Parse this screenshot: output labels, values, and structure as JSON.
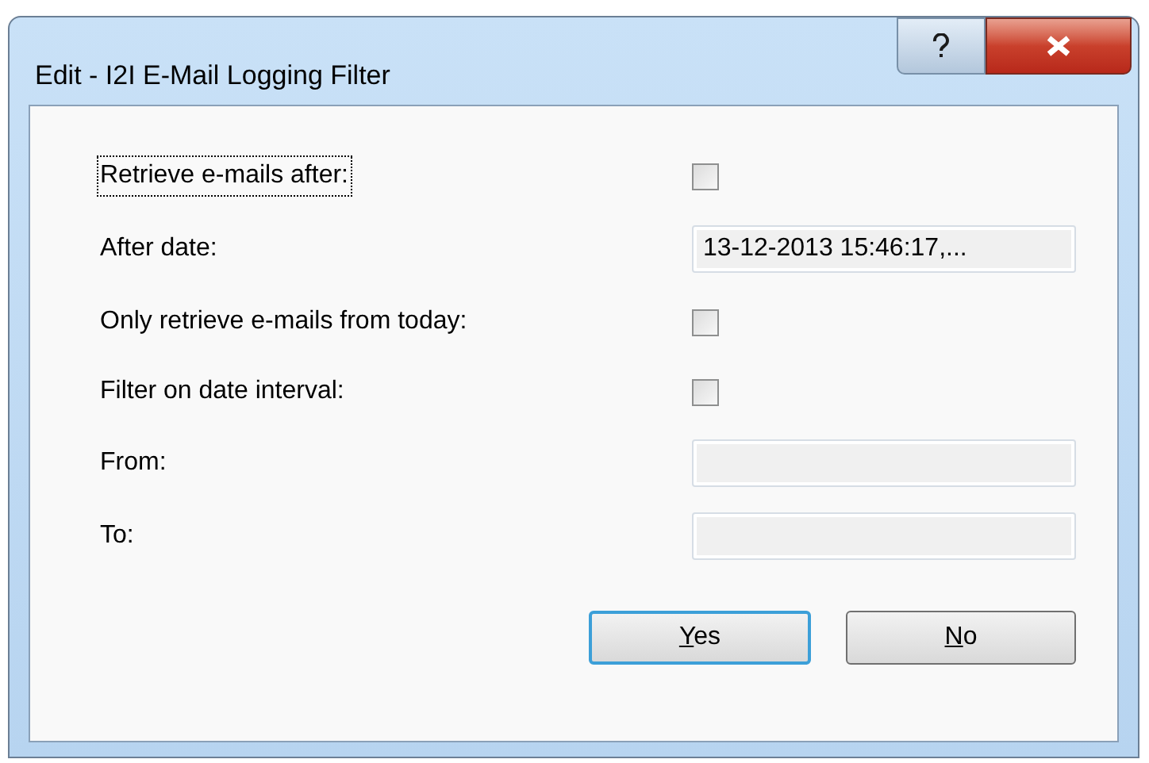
{
  "window": {
    "title": "Edit - I2I E-Mail Logging Filter"
  },
  "rows": [
    {
      "kind": "checkbox",
      "label": "Retrieve e-mails after:",
      "focused": true,
      "checked": false
    },
    {
      "kind": "field",
      "label": "After date:",
      "focused": false,
      "value": "13-12-2013 15:46:17,...",
      "disabled": true
    },
    {
      "kind": "checkbox",
      "label": "Only retrieve e-mails from today:",
      "focused": false,
      "checked": false
    },
    {
      "kind": "checkbox",
      "label": "Filter on date interval:",
      "focused": false,
      "checked": false
    },
    {
      "kind": "field",
      "label": "From:",
      "focused": false,
      "disabled": true
    },
    {
      "kind": "field",
      "label": "To:",
      "focused": false,
      "disabled": true
    }
  ],
  "buttons": [
    {
      "label": "Yes",
      "access_key_underlined": true,
      "default": true
    },
    {
      "label": "No",
      "access_key_underlined": true,
      "default": false
    }
  ]
}
